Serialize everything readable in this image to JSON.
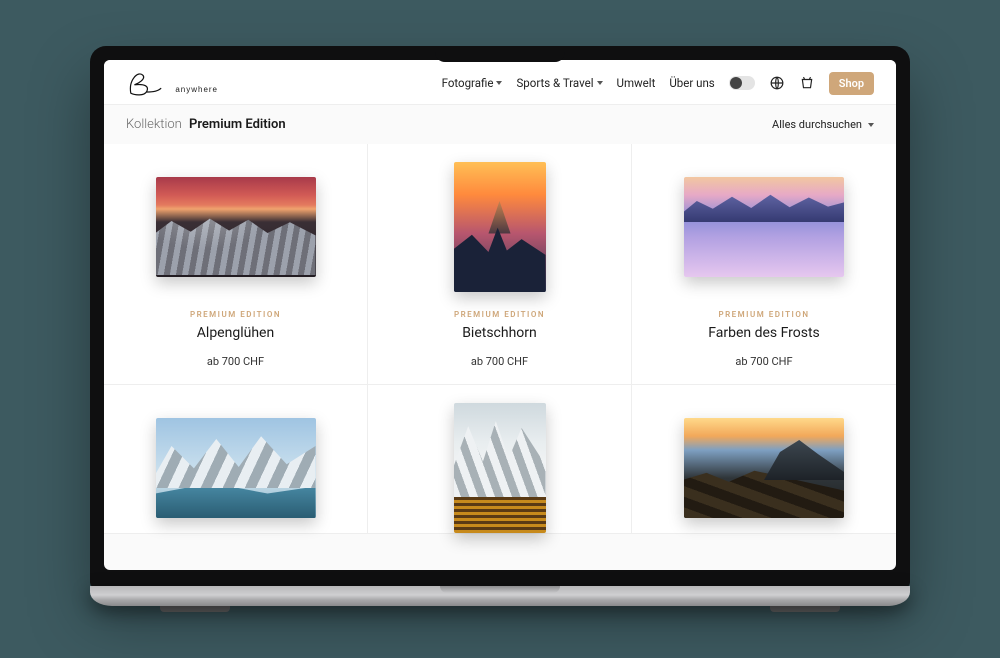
{
  "brand": {
    "name": "Be",
    "sub": "anywhere"
  },
  "nav": {
    "items": [
      {
        "label": "Fotografie",
        "dropdown": true
      },
      {
        "label": "Sports & Travel",
        "dropdown": true
      },
      {
        "label": "Umwelt",
        "dropdown": false
      },
      {
        "label": "Über uns",
        "dropdown": false
      }
    ],
    "shop_label": "Shop"
  },
  "collection": {
    "prefix": "Kollektion",
    "title": "Premium Edition",
    "browse_label": "Alles durchsuchen"
  },
  "products": [
    {
      "tag": "PREMIUM EDITION",
      "name": "Alpenglühen",
      "price": "ab 700 CHF",
      "orientation": "land",
      "art": "art1"
    },
    {
      "tag": "PREMIUM EDITION",
      "name": "Bietschhorn",
      "price": "ab 700 CHF",
      "orientation": "port",
      "art": "art2"
    },
    {
      "tag": "PREMIUM EDITION",
      "name": "Farben des Frosts",
      "price": "ab 700 CHF",
      "orientation": "land",
      "art": "art3"
    },
    {
      "tag": "",
      "name": "",
      "price": "",
      "orientation": "land",
      "art": "art4"
    },
    {
      "tag": "",
      "name": "",
      "price": "",
      "orientation": "port",
      "art": "art5"
    },
    {
      "tag": "",
      "name": "",
      "price": "",
      "orientation": "land",
      "art": "art6"
    }
  ]
}
